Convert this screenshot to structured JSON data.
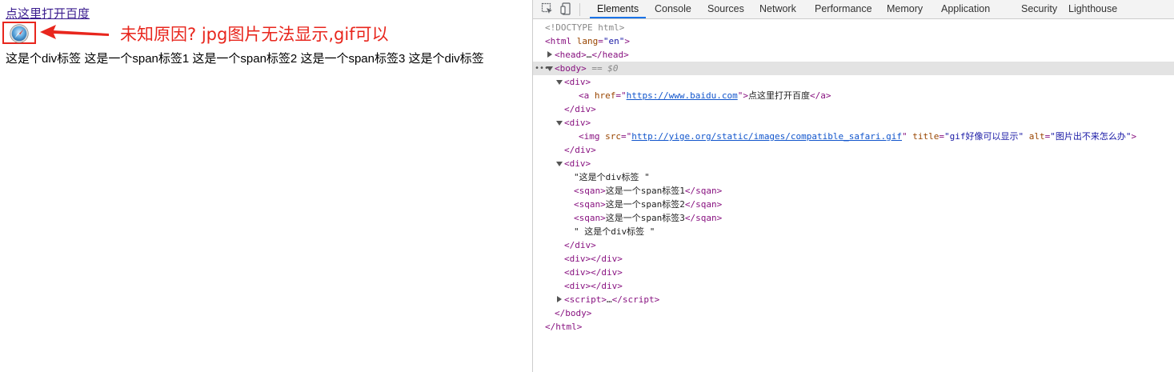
{
  "page": {
    "link_text": "点这里打开百度",
    "annotation": "未知原因? jpg图片无法显示,gif可以",
    "text_line": [
      "这是个div标签",
      "这是一个span标签1",
      "这是一个span标签2",
      "这是一个span标签3",
      "这是个div标签"
    ]
  },
  "devtools": {
    "tabs": [
      {
        "label": "Elements",
        "active": true
      },
      {
        "label": "Console"
      },
      {
        "label": "Sources"
      },
      {
        "label": "Network"
      },
      {
        "label": "Performance"
      },
      {
        "label": "Memory"
      },
      {
        "label": "Application"
      },
      {
        "label": "Security"
      },
      {
        "label": "Lighthouse"
      }
    ],
    "tree": {
      "doctype": "<!DOCTYPE html>",
      "html_open": "html",
      "lang_attr": "lang",
      "lang_val": "\"en\"",
      "head_line": "head",
      "head_ellipsis": "…",
      "body_tag": "body",
      "body_marker": "== $0",
      "div": "div",
      "a_tag": "a",
      "href_attr": "href",
      "href_val": "https://www.baidu.com",
      "a_text": "点这里打开百度",
      "img_tag": "img",
      "src_attr": "src",
      "src_val": "http://yige.org/static/images/compatible_safari.gif",
      "title_attr": "title",
      "title_val": "\"gif好像可以显示\"",
      "alt_attr": "alt",
      "alt_val": "\"图片出不来怎么办\"",
      "text1": "\"这是个div标签 \"",
      "sqan": "sqan",
      "span1": "这是一个span标签1",
      "span2": "这是一个span标签2",
      "span3": "这是一个span标签3",
      "text2": "\" 这是个div标签 \"",
      "script": "script",
      "script_ellipsis": "…",
      "body_close": "body",
      "html_close": "html"
    }
  },
  "colors": {
    "annotation_red": "#e8261d",
    "tab_accent": "#1a73e8",
    "tag_purple": "#881280",
    "attr_brown": "#994500",
    "value_blue": "#1a1aa6"
  }
}
